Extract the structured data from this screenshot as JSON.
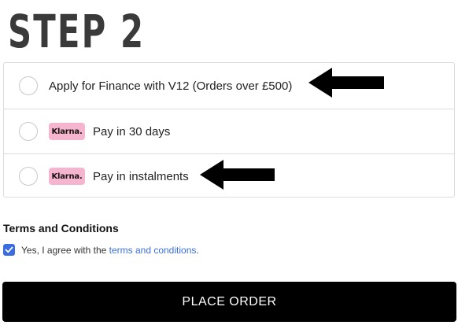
{
  "step": {
    "title": "STEP 2"
  },
  "payment_options": [
    {
      "label": "Apply for Finance with V12 (Orders over £500)",
      "badge": "",
      "selected": false
    },
    {
      "label": "Pay in 30 days",
      "badge": "Klarna.",
      "selected": false
    },
    {
      "label": "Pay in instalments",
      "badge": "Klarna.",
      "selected": false
    }
  ],
  "terms": {
    "heading": "Terms and Conditions",
    "agree_prefix": "Yes, I agree with the ",
    "link_text": "terms and conditions",
    "agree_suffix": ".",
    "checked": true
  },
  "actions": {
    "place_order_label": "PLACE ORDER"
  },
  "colors": {
    "klarna_badge": "#f5b5cf",
    "link": "#3b6de0",
    "checkbox": "#3b6de0",
    "button_bg": "#000000",
    "annotation_arrow": "#000000"
  },
  "icons": [
    "radio-icon",
    "klarna-logo",
    "checkmark-icon",
    "arrow-left-icon"
  ]
}
